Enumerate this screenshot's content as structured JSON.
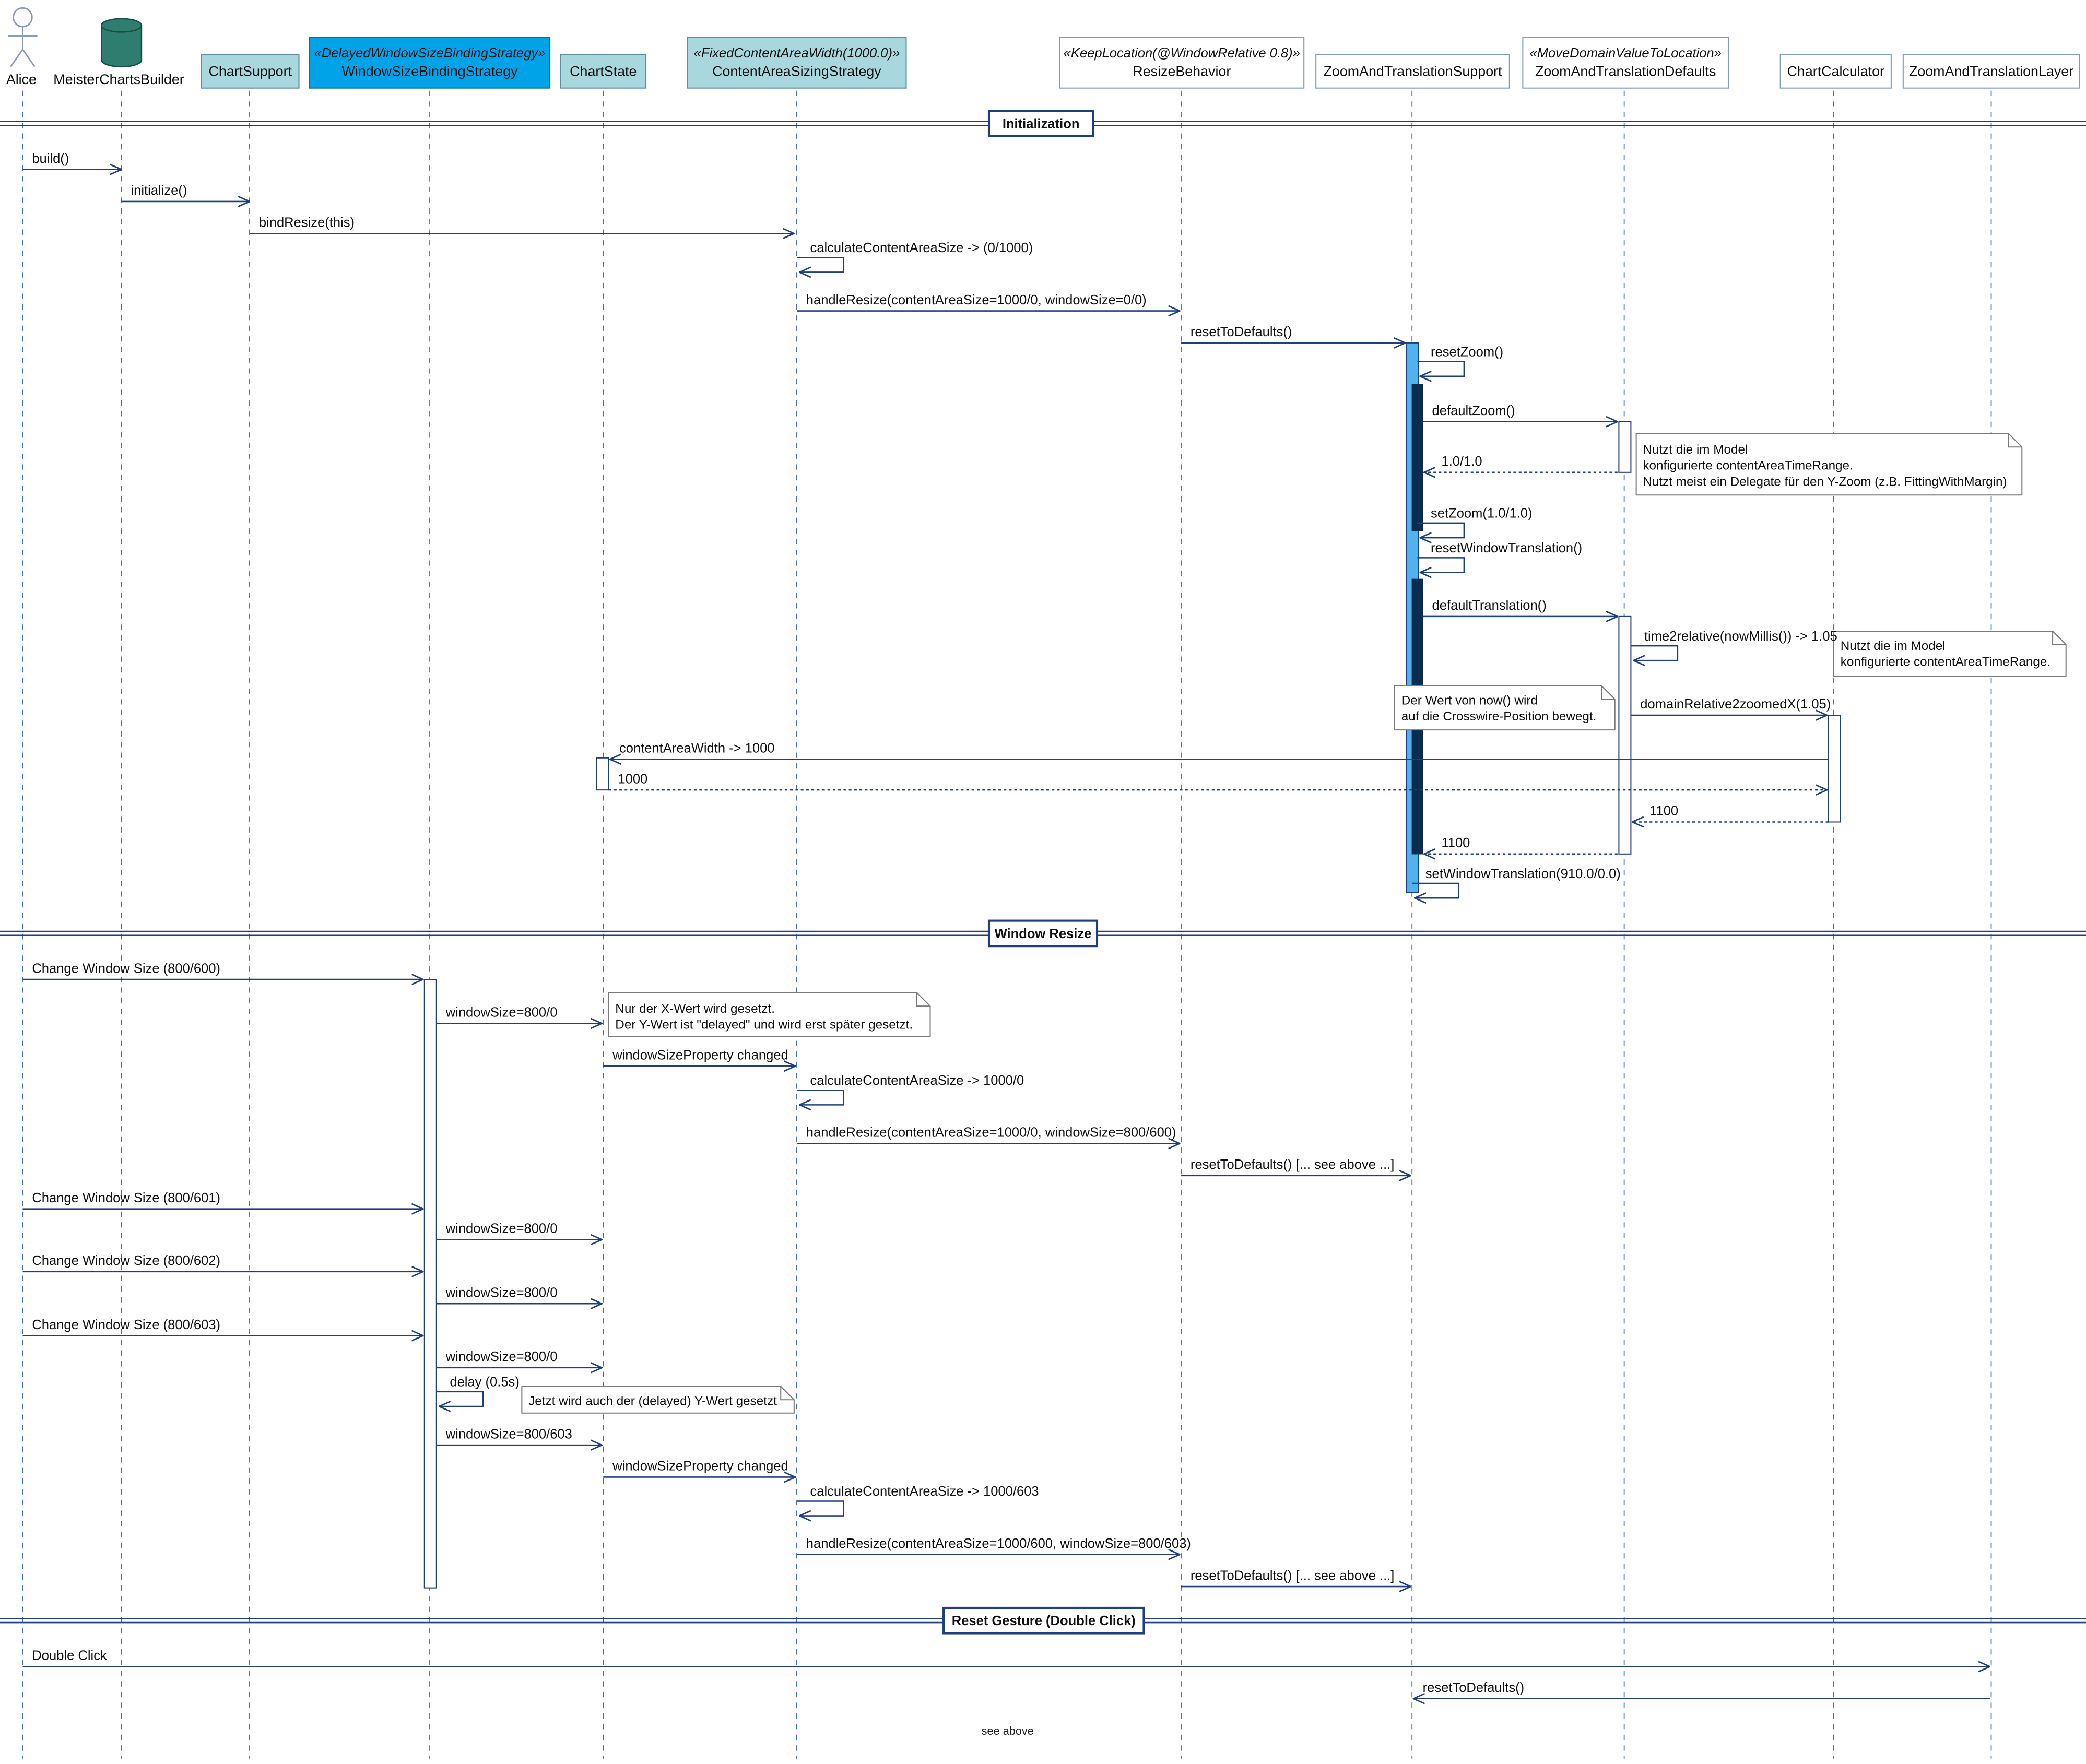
{
  "participants": [
    {
      "id": "alice",
      "label": "Alice",
      "kind": "actor"
    },
    {
      "id": "builder",
      "label": "MeisterChartsBuilder",
      "kind": "database"
    },
    {
      "id": "chartsupport",
      "label": "ChartSupport",
      "kind": "box",
      "fill": "#a8d8de"
    },
    {
      "id": "wsbs",
      "stereotype": "«DelayedWindowSizeBindingStrategy»",
      "label": "WindowSizeBindingStrategy",
      "kind": "box",
      "fill": "#00a2e8"
    },
    {
      "id": "chartstate",
      "label": "ChartState",
      "kind": "box",
      "fill": "#a8d8de"
    },
    {
      "id": "casizing",
      "stereotype": "«FixedContentAreaWidth(1000.0)»",
      "label": "ContentAreaSizingStrategy",
      "kind": "box",
      "fill": "#a8d8de"
    },
    {
      "id": "resize",
      "stereotype": "«KeepLocation(@WindowRelative 0.8)»",
      "label": "ResizeBehavior",
      "kind": "box",
      "fill": "#ffffff"
    },
    {
      "id": "zts",
      "label": "ZoomAndTranslationSupport",
      "kind": "box",
      "fill": "#ffffff"
    },
    {
      "id": "ztd",
      "stereotype": "«MoveDomainValueToLocation»",
      "label": "ZoomAndTranslationDefaults",
      "kind": "box",
      "fill": "#ffffff"
    },
    {
      "id": "calc",
      "label": "ChartCalculator",
      "kind": "box",
      "fill": "#ffffff"
    },
    {
      "id": "ztl",
      "label": "ZoomAndTranslationLayer",
      "kind": "box",
      "fill": "#ffffff"
    }
  ],
  "dividers": [
    {
      "label": "Initialization"
    },
    {
      "label": "Window Resize"
    },
    {
      "label": "Reset Gesture (Double Click)"
    }
  ],
  "messages": [
    {
      "from": "alice",
      "to": "builder",
      "label": "build()",
      "type": "sync"
    },
    {
      "from": "builder",
      "to": "chartsupport",
      "label": "initialize()",
      "type": "sync"
    },
    {
      "from": "chartsupport",
      "to": "casizing",
      "label": "bindResize(this)",
      "type": "sync"
    },
    {
      "from": "casizing",
      "to": "casizing",
      "label": "calculateContentAreaSize -> (0/1000)",
      "type": "self"
    },
    {
      "from": "casizing",
      "to": "resize",
      "label": "handleResize(contentAreaSize=1000/0, windowSize=0/0)",
      "type": "sync"
    },
    {
      "from": "resize",
      "to": "zts",
      "label": "resetToDefaults()",
      "type": "sync"
    },
    {
      "from": "zts",
      "to": "zts",
      "label": "resetZoom()",
      "type": "self"
    },
    {
      "from": "zts",
      "to": "ztd",
      "label": "defaultZoom()",
      "type": "sync"
    },
    {
      "from": "ztd",
      "to": "zts",
      "label": "1.0/1.0",
      "type": "return"
    },
    {
      "from": "zts",
      "to": "zts",
      "label": "setZoom(1.0/1.0)",
      "type": "self"
    },
    {
      "from": "zts",
      "to": "zts",
      "label": "resetWindowTranslation()",
      "type": "self"
    },
    {
      "from": "zts",
      "to": "ztd",
      "label": "defaultTranslation()",
      "type": "sync"
    },
    {
      "from": "ztd",
      "to": "ztd",
      "label": "time2relative(nowMillis()) -> 1.05",
      "type": "self"
    },
    {
      "from": "ztd",
      "to": "calc",
      "label": "domainRelative2zoomedX(1.05)",
      "type": "sync"
    },
    {
      "from": "calc",
      "to": "chartstate",
      "label": "contentAreaWidth -> 1000",
      "type": "sync"
    },
    {
      "from": "chartstate",
      "to": "calc",
      "label": "1000",
      "type": "return"
    },
    {
      "from": "calc",
      "to": "ztd",
      "label": "1100",
      "type": "return"
    },
    {
      "from": "ztd",
      "to": "zts",
      "label": "1100",
      "type": "return"
    },
    {
      "from": "zts",
      "to": "zts",
      "label": "setWindowTranslation(910.0/0.0)",
      "type": "self"
    },
    {
      "from": "alice",
      "to": "wsbs",
      "label": "Change Window Size (800/600)",
      "type": "sync"
    },
    {
      "from": "wsbs",
      "to": "chartstate",
      "label": "windowSize=800/0",
      "type": "sync"
    },
    {
      "from": "chartstate",
      "to": "casizing",
      "label": "windowSizeProperty changed",
      "type": "sync"
    },
    {
      "from": "casizing",
      "to": "casizing",
      "label": "calculateContentAreaSize -> 1000/0",
      "type": "self"
    },
    {
      "from": "casizing",
      "to": "resize",
      "label": "handleResize(contentAreaSize=1000/0, windowSize=800/600)",
      "type": "sync"
    },
    {
      "from": "resize",
      "to": "zts",
      "label": "resetToDefaults() [... see above ...]",
      "type": "sync"
    },
    {
      "from": "alice",
      "to": "wsbs",
      "label": "Change Window Size (800/601)",
      "type": "sync"
    },
    {
      "from": "wsbs",
      "to": "chartstate",
      "label": "windowSize=800/0",
      "type": "sync"
    },
    {
      "from": "alice",
      "to": "wsbs",
      "label": "Change Window Size (800/602)",
      "type": "sync"
    },
    {
      "from": "wsbs",
      "to": "chartstate",
      "label": "windowSize=800/0",
      "type": "sync"
    },
    {
      "from": "alice",
      "to": "wsbs",
      "label": "Change Window Size (800/603)",
      "type": "sync"
    },
    {
      "from": "wsbs",
      "to": "chartstate",
      "label": "windowSize=800/0",
      "type": "sync"
    },
    {
      "from": "wsbs",
      "to": "wsbs",
      "label": "delay (0.5s)",
      "type": "self"
    },
    {
      "from": "wsbs",
      "to": "chartstate",
      "label": "windowSize=800/603",
      "type": "sync"
    },
    {
      "from": "chartstate",
      "to": "casizing",
      "label": "windowSizeProperty changed",
      "type": "sync"
    },
    {
      "from": "casizing",
      "to": "casizing",
      "label": "calculateContentAreaSize -> 1000/603",
      "type": "self"
    },
    {
      "from": "casizing",
      "to": "resize",
      "label": "handleResize(contentAreaSize=1000/600, windowSize=800/603)",
      "type": "sync"
    },
    {
      "from": "resize",
      "to": "zts",
      "label": "resetToDefaults() [... see above ...]",
      "type": "sync"
    },
    {
      "from": "alice",
      "to": "ztl",
      "label": "Double Click",
      "type": "sync"
    },
    {
      "from": "ztl",
      "to": "zts",
      "label": "resetToDefaults()",
      "type": "sync"
    }
  ],
  "notes": [
    {
      "lines": [
        "Nutzt die im Model",
        "konfigurierte contentAreaTimeRange.",
        "Nutzt meist ein Delegate für den Y-Zoom (z.B. FittingWithMargin)"
      ]
    },
    {
      "lines": [
        "Nutzt die im Model",
        "konfigurierte contentAreaTimeRange."
      ]
    },
    {
      "lines": [
        "Der Wert von now() wird",
        "auf die Crosswire-Position bewegt."
      ]
    },
    {
      "lines": [
        "Nur der X-Wert wird gesetzt.",
        "Der Y-Wert ist \"delayed\" und wird erst später gesetzt."
      ]
    },
    {
      "lines": [
        "Jetzt wird auch der (delayed) Y-Wert gesetzt"
      ]
    }
  ],
  "footer_text": "see above",
  "colors": {
    "line": "#1f3f7f",
    "lifeline": "#3b6fd0",
    "activation_light": "#4fb4ec",
    "activation_dark": "#0b2b4f",
    "note_border": "#7a7a7a",
    "actor": "#8a9bb5",
    "db_fill": "#2e7d6f"
  }
}
